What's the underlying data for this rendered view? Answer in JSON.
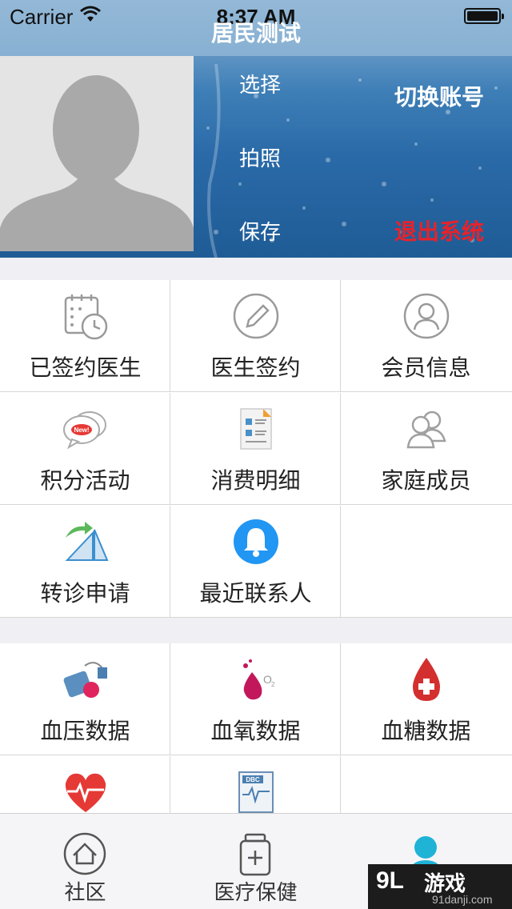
{
  "status_bar": {
    "carrier": "Carrier",
    "time": "8:37 AM"
  },
  "nav": {
    "title": "居民测试"
  },
  "profile": {
    "photo_actions": [
      "选择",
      "拍照",
      "保存"
    ],
    "switch_account": "切换账号",
    "logout": "退出系统",
    "logout_color": "#e8222a"
  },
  "services": [
    {
      "label": "已签约医生",
      "icon": "calendar-clock-icon"
    },
    {
      "label": "医生签约",
      "icon": "pencil-icon"
    },
    {
      "label": "会员信息",
      "icon": "member-icon"
    },
    {
      "label": "积分活动",
      "icon": "new-chat-icon"
    },
    {
      "label": "消费明细",
      "icon": "document-list-icon"
    },
    {
      "label": "家庭成员",
      "icon": "family-icon"
    },
    {
      "label": "转诊申请",
      "icon": "referral-arrow-icon"
    },
    {
      "label": "最近联系人",
      "icon": "bell-icon"
    }
  ],
  "health_data": [
    {
      "label": "血压数据",
      "icon": "blood-pressure-icon"
    },
    {
      "label": "血氧数据",
      "icon": "blood-oxygen-icon"
    },
    {
      "label": "血糖数据",
      "icon": "blood-sugar-icon"
    },
    {
      "label": "",
      "icon": "heart-rate-icon"
    },
    {
      "label": "",
      "icon": "ecg-report-icon"
    }
  ],
  "tabbar": {
    "items": [
      {
        "label": "社区",
        "icon": "home-icon"
      },
      {
        "label": "医疗保健",
        "icon": "medicine-jar-icon"
      },
      {
        "label": "",
        "icon": "person-icon"
      }
    ],
    "active_color": "#1fb3d6"
  },
  "watermark": {
    "logo": "9L",
    "main": "游戏",
    "sub": "91danji.com"
  }
}
